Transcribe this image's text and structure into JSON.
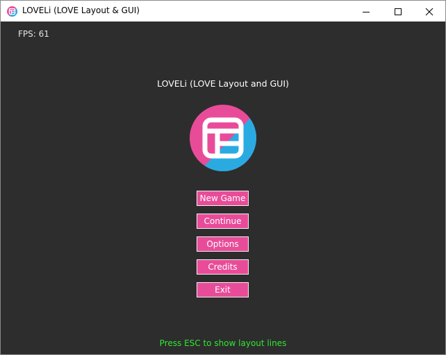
{
  "window": {
    "title": "LOVELi (LOVE Layout & GUI)",
    "icon": "loveli-logo-icon",
    "controls": [
      "minimize-icon",
      "maximize-icon",
      "close-icon"
    ]
  },
  "game": {
    "fps_label": "FPS: 61",
    "title": "LOVELi (LOVE Layout and GUI)",
    "logo": "loveli-logo-icon",
    "menu": [
      {
        "label": "New Game"
      },
      {
        "label": "Continue"
      },
      {
        "label": "Options"
      },
      {
        "label": "Credits"
      },
      {
        "label": "Exit"
      }
    ],
    "hint": "Press ESC to show layout lines"
  },
  "colors": {
    "background": "#2d2d2d",
    "button": "#e84c99",
    "button_border": "#f2f2f2",
    "logo_pink": "#e84c99",
    "logo_blue": "#29abe2",
    "hint": "#2fe82f"
  }
}
